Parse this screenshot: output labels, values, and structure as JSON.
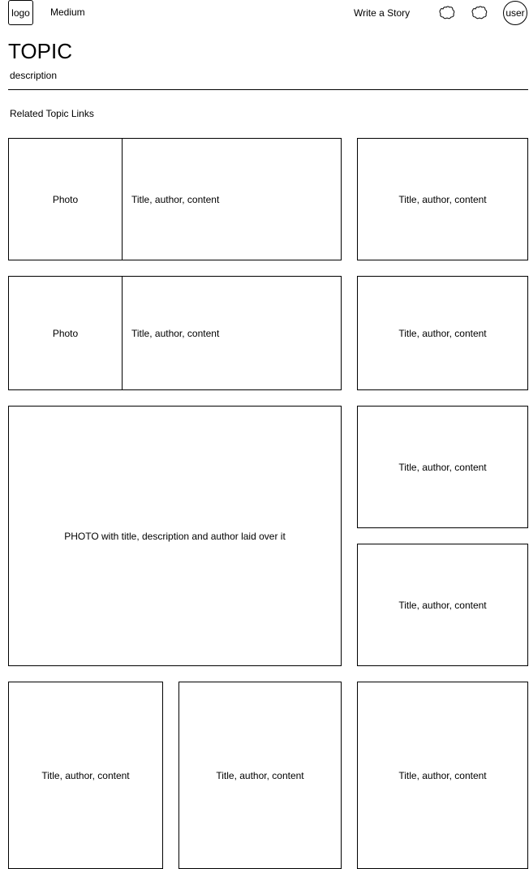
{
  "header": {
    "logo_label": "logo",
    "brand_label": "Medium",
    "write_story_label": "Write a Story",
    "icons": [
      "cloud-icon",
      "cloud-icon"
    ],
    "user_label": "user"
  },
  "topic": {
    "title": "TOPIC",
    "description": "description",
    "related_links_label": "Related Topic Links"
  },
  "cards": {
    "photo_label": "Photo",
    "featured_photo_label": "PHOTO with title, description and author laid over it",
    "content_label": "Title, author, content"
  }
}
